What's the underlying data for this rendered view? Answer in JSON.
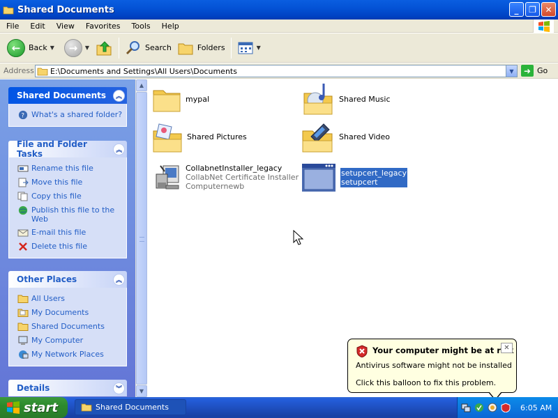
{
  "window": {
    "title": "Shared Documents"
  },
  "menu": {
    "items": [
      "File",
      "Edit",
      "View",
      "Favorites",
      "Tools",
      "Help"
    ]
  },
  "toolbar": {
    "back_label": "Back",
    "search_label": "Search",
    "folders_label": "Folders"
  },
  "address": {
    "label": "Address",
    "path": "E:\\Documents and Settings\\All Users\\Documents",
    "go_label": "Go"
  },
  "sidebar": {
    "shared_box": {
      "title": "Shared Documents",
      "link": "What's a shared folder?"
    },
    "tasks_box": {
      "title": "File and Folder Tasks",
      "items": [
        "Rename this file",
        "Move this file",
        "Copy this file",
        "Publish this file to the Web",
        "E-mail this file",
        "Delete this file"
      ]
    },
    "places_box": {
      "title": "Other Places",
      "items": [
        "All Users",
        "My Documents",
        "Shared Documents",
        "My Computer",
        "My Network Places"
      ]
    },
    "details_box": {
      "title": "Details"
    }
  },
  "files": [
    {
      "name": "mypal",
      "icon": "folder-icon"
    },
    {
      "name": "Shared Music",
      "icon": "music-folder-icon"
    },
    {
      "name": "Shared Pictures",
      "icon": "pictures-folder-icon"
    },
    {
      "name": "Shared Video",
      "icon": "video-folder-icon"
    },
    {
      "name": "CollabnetInstaller_legacy",
      "line2": "CollabNet Certificate Installer",
      "line3": "Computernewb",
      "icon": "installer-icon"
    },
    {
      "name": "setupcert_legacy",
      "line2": "setupcert",
      "icon": "application-icon",
      "selected": true
    }
  ],
  "balloon": {
    "title": "Your computer might be at risk",
    "line1": "Antivirus software might not be installed",
    "line2": "Click this balloon to fix this problem."
  },
  "taskbar": {
    "start_label": "start",
    "task_label": "Shared Documents",
    "clock": "6:05 AM"
  },
  "colors": {
    "title_blue": "#0453d6",
    "sidebar_link": "#215dc6",
    "selection": "#316ac5",
    "start_green": "#2c8a2c"
  }
}
